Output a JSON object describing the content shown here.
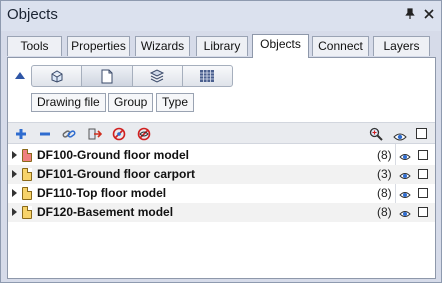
{
  "window": {
    "title": "Objects",
    "pin_icon": "pin-icon",
    "close_icon": "close-icon"
  },
  "tabs": [
    {
      "label": "Tools",
      "active": false
    },
    {
      "label": "Properties",
      "active": false
    },
    {
      "label": "Wizards",
      "active": false
    },
    {
      "label": "Library",
      "active": false
    },
    {
      "label": "Objects",
      "active": true
    },
    {
      "label": "Connect",
      "active": false
    },
    {
      "label": "Layers",
      "active": false
    }
  ],
  "view_toggle": {
    "icons": [
      "3d-view-icon",
      "page-view-icon",
      "layers-view-icon",
      "grid-view-icon"
    ],
    "active_index": 1
  },
  "grouping": {
    "buttons": [
      {
        "label": "Drawing file"
      },
      {
        "label": "Group"
      },
      {
        "label": "Type"
      }
    ]
  },
  "toolbar": {
    "icons": [
      "expand-all-icon",
      "collapse-all-icon",
      "link-icon",
      "transfer-icon",
      "hide-icon",
      "hide-all-icon"
    ],
    "right_icons": [
      "zoom-icon",
      "eye-icon",
      "checkbox-icon"
    ]
  },
  "files": [
    {
      "name": "DF100-Ground floor model",
      "count": "(8)",
      "icon_color": "#f08080"
    },
    {
      "name": "DF101-Ground floor carport",
      "count": "(3)",
      "icon_color": "#f7d36a"
    },
    {
      "name": "DF110-Top floor model",
      "count": "(8)",
      "icon_color": "#f7d36a"
    },
    {
      "name": "DF120-Basement model",
      "count": "(8)",
      "icon_color": "#f7d36a"
    }
  ]
}
